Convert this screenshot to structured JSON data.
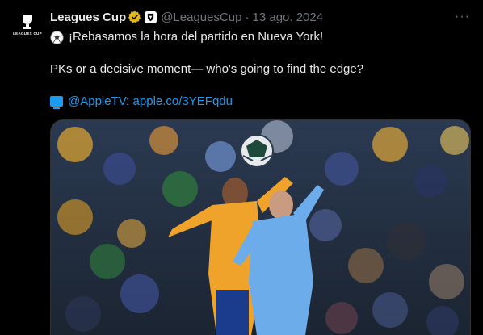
{
  "account": {
    "avatar_text": "LEAGUES CUP",
    "name": "Leagues Cup",
    "handle": "@LeaguesCup",
    "separator": "·",
    "date": "13 ago. 2024"
  },
  "post": {
    "line1": "¡Rebasamos la hora del partido en Nueva York!",
    "line2": "PKs or a decisive moment— who's going to find the edge?",
    "mention": "@AppleTV",
    "colon": ": ",
    "url": "apple.co/3YEFqdu"
  },
  "menu": {
    "more_label": "···"
  },
  "icons": {
    "verified": "verified-badge-icon",
    "affiliate": "affiliate-badge-icon",
    "ball": "soccer-ball-icon",
    "tv": "tv-icon"
  },
  "colors": {
    "background": "#000000",
    "text": "#e7e9ea",
    "muted": "#71767b",
    "link": "#1d9bf0",
    "verified": "#e2b719"
  }
}
